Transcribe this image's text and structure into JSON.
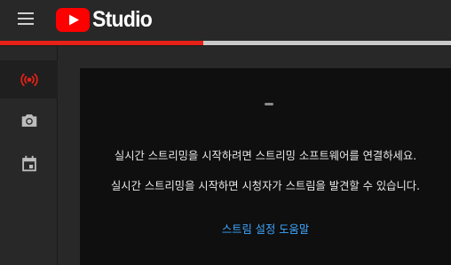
{
  "header": {
    "logo_text": "Studio",
    "menu_icon": "hamburger-menu-icon",
    "logo_icon": "youtube-play-logo-icon"
  },
  "progress": {
    "fraction": 0.45,
    "fill_color": "#e62117",
    "track_color": "#c9c9c9"
  },
  "sidebar": {
    "items": [
      {
        "icon": "live-broadcast-icon",
        "active": true,
        "color": "#e62117"
      },
      {
        "icon": "camera-icon",
        "active": false
      },
      {
        "icon": "calendar-icon",
        "active": false
      }
    ]
  },
  "main": {
    "message_1": "실시간 스트리밍을 시작하려면 스트리밍 소프트웨어를 연결하세요.",
    "message_2": "실시간 스트리밍을 시작하면 시청자가 스트림을 발견할 수 있습니다.",
    "help_link": "스트림 설정 도움말",
    "link_color": "#3ea6ff"
  }
}
